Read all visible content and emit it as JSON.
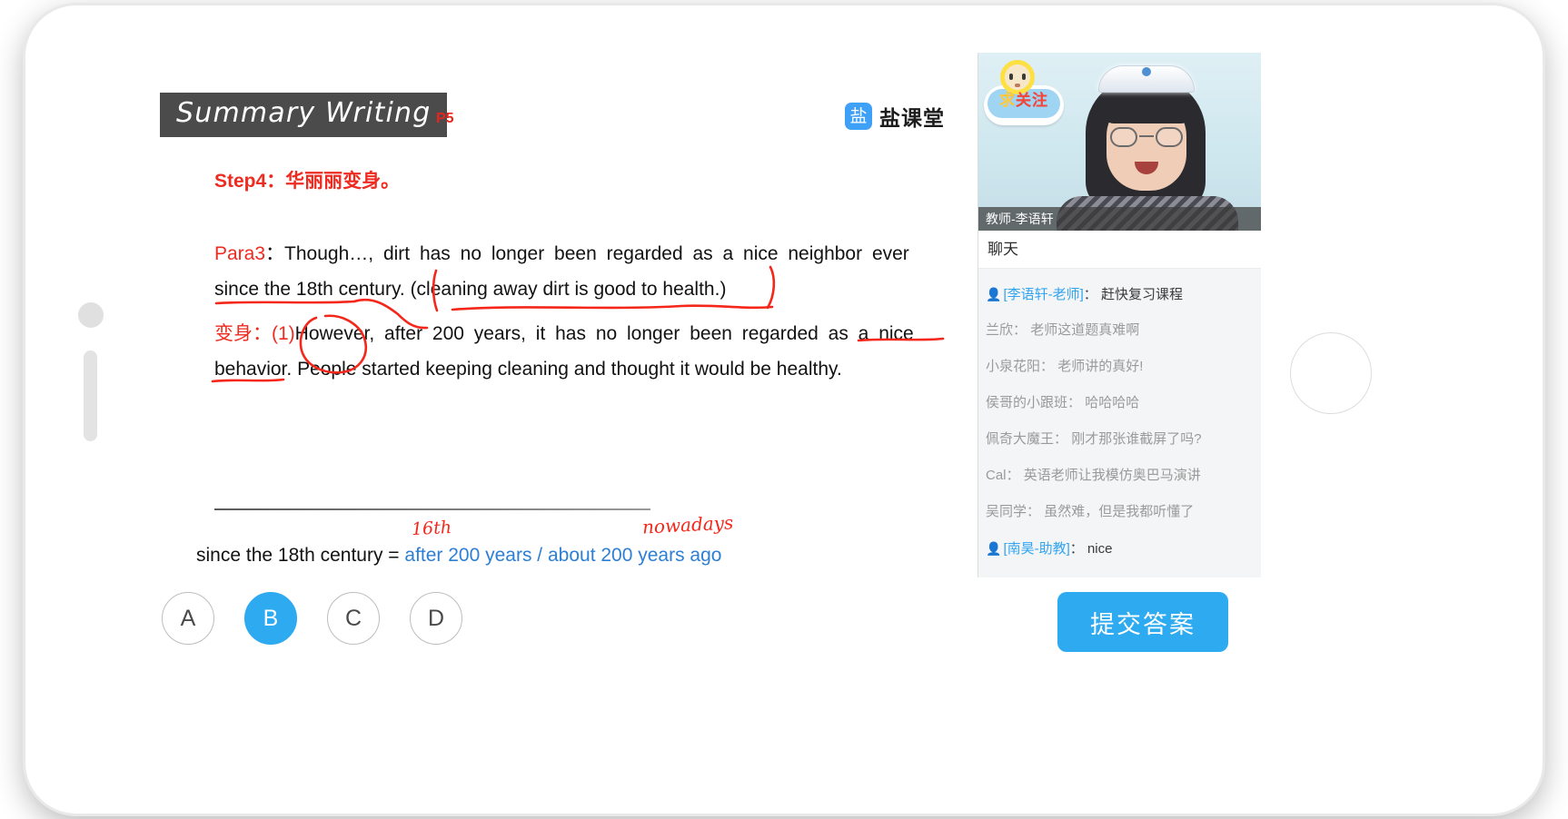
{
  "slide": {
    "title": "Summary Writing",
    "page_label": "P5",
    "brand": {
      "icon_char": "盐",
      "name": "盐课堂"
    },
    "step_line": "Step4：华丽丽变身。",
    "para3_label": "Para3",
    "para3_sep": "：",
    "para3_line1": "Though…, dirt has no longer been regarded as a nice neighbor ever",
    "para3_line2": "since the 18th century. (cleaning away dirt is good to health.)",
    "bianshen_label": "变身",
    "bianshen_sep": "：",
    "bianshen_number": "(1)",
    "bianshen_line1": "However, after 200 years, it has no longer been regarded as a nice",
    "bianshen_line2": "behavior. People started keeping cleaning and thought it would be healthy.",
    "bottom_black": "since the 18th century  = ",
    "bottom_blue": "after 200 years / about 200 years ago",
    "handwriting_16th": "16th",
    "handwriting_nowadays": "nowadays"
  },
  "video": {
    "teacher_name_bar": "教师-李语轩",
    "sticker_text_1": "求",
    "sticker_text_2": "关",
    "sticker_text_3": "注"
  },
  "chat": {
    "header": "聊天",
    "messages": [
      {
        "icon": "person-icon",
        "name": "[李语轩-老师]",
        "sep": "：",
        "text": "赶快复习课程",
        "staff": true
      },
      {
        "icon": "",
        "name": "兰欣",
        "sep": "：",
        "text": "老师这道题真难啊",
        "staff": false
      },
      {
        "icon": "",
        "name": "小泉花阳",
        "sep": "：",
        "text": "老师讲的真好!",
        "staff": false
      },
      {
        "icon": "",
        "name": "侯哥的小跟班",
        "sep": "：",
        "text": "哈哈哈哈",
        "staff": false
      },
      {
        "icon": "",
        "name": "佩奇大魔王",
        "sep": "：",
        "text": "刚才那张谁截屏了吗?",
        "staff": false
      },
      {
        "icon": "",
        "name": "Cal",
        "sep": "：",
        "text": "英语老师让我模仿奥巴马演讲",
        "staff": false
      },
      {
        "icon": "",
        "name": "吴同学",
        "sep": "：",
        "text": "虽然难，但是我都听懂了",
        "staff": false
      },
      {
        "icon": "person-icon",
        "name": "[南昊-助教]",
        "sep": "：",
        "text": "nice",
        "staff": true
      }
    ]
  },
  "answer_bar": {
    "options": [
      {
        "label": "A",
        "selected": false
      },
      {
        "label": "B",
        "selected": true
      },
      {
        "label": "C",
        "selected": false
      },
      {
        "label": "D",
        "selected": false
      }
    ],
    "submit_label": "提交答案"
  },
  "colors": {
    "accent": "#2eaaf0",
    "red": "#ee2b20",
    "blue_text": "#2d7fd6",
    "ink_red": "#f4271a"
  }
}
